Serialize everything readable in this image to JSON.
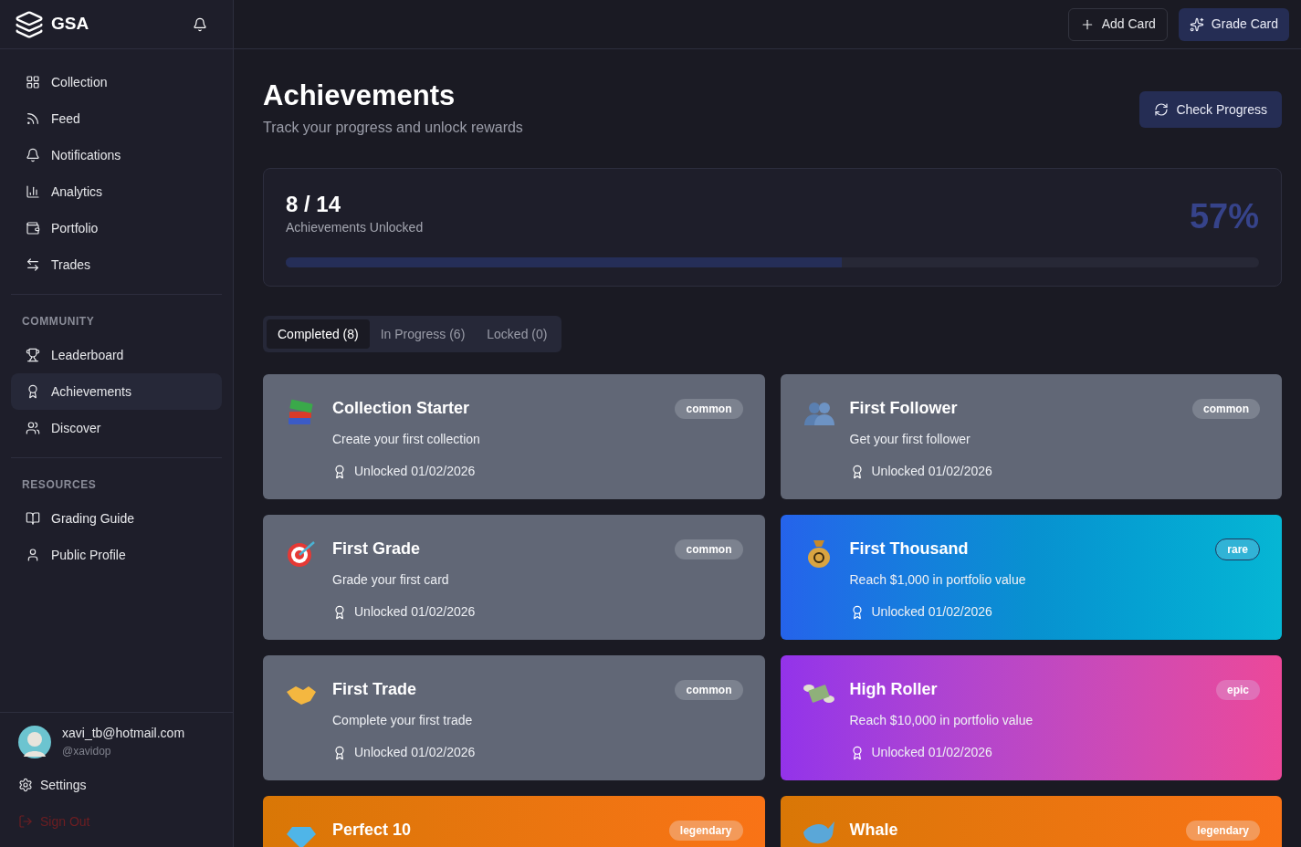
{
  "brand": {
    "name": "GSA"
  },
  "nav": [
    {
      "label": "Collection",
      "selected": false
    },
    {
      "label": "Feed",
      "selected": false
    },
    {
      "label": "Notifications",
      "selected": false
    },
    {
      "label": "Analytics",
      "selected": false
    },
    {
      "label": "Portfolio",
      "selected": false
    },
    {
      "label": "Trades",
      "selected": false
    }
  ],
  "sections": [
    {
      "title": "COMMUNITY",
      "items": [
        {
          "label": "Leaderboard",
          "selected": false
        },
        {
          "label": "Achievements",
          "selected": true
        },
        {
          "label": "Discover",
          "selected": false
        }
      ]
    },
    {
      "title": "RESOURCES",
      "items": [
        {
          "label": "Grading Guide",
          "selected": false
        },
        {
          "label": "Public Profile",
          "selected": false
        }
      ]
    }
  ],
  "user": {
    "email": "xavi_tb@hotmail.com",
    "handle": "@xavidop"
  },
  "footer": {
    "settings": "Settings",
    "sign_out": "Sign Out"
  },
  "topbar": {
    "buttons": [
      {
        "label": "Add Card",
        "kind": "outline"
      },
      {
        "label": "Grade Card",
        "kind": "primary"
      }
    ]
  },
  "page": {
    "title": "Achievements",
    "subtitle": "Track your progress and unlock rewards",
    "action": "Check Progress"
  },
  "summary": {
    "count": "8 / 14",
    "label": "Achievements Unlocked",
    "percent": "57%",
    "level": 0.571
  },
  "tabs": [
    {
      "label": "Completed (8)",
      "selected": true
    },
    {
      "label": "In Progress (6)",
      "selected": false
    },
    {
      "label": "Locked (0)",
      "selected": false
    }
  ],
  "achievements": [
    {
      "title": "Collection Starter",
      "description": "Create your first collection",
      "unlocked": "Unlocked 01/02/2026",
      "rarity": "common",
      "kind": "common"
    },
    {
      "title": "First Follower",
      "description": "Get your first follower",
      "unlocked": "Unlocked 01/02/2026",
      "rarity": "common",
      "kind": "common"
    },
    {
      "title": "First Grade",
      "description": "Grade your first card",
      "unlocked": "Unlocked 01/02/2026",
      "rarity": "common",
      "kind": "common"
    },
    {
      "title": "First Thousand",
      "description": "Reach $1,000 in portfolio value",
      "unlocked": "Unlocked 01/02/2026",
      "rarity": "rare",
      "kind": "rare"
    },
    {
      "title": "First Trade",
      "description": "Complete your first trade",
      "unlocked": "Unlocked 01/02/2026",
      "rarity": "common",
      "kind": "common"
    },
    {
      "title": "High Roller",
      "description": "Reach $10,000 in portfolio value",
      "unlocked": "Unlocked 01/02/2026",
      "rarity": "epic",
      "kind": "epic"
    },
    {
      "title": "Perfect 10",
      "rarity": "legendary",
      "kind": "legendary"
    },
    {
      "title": "Whale",
      "rarity": "legendary",
      "kind": "legendary"
    }
  ]
}
